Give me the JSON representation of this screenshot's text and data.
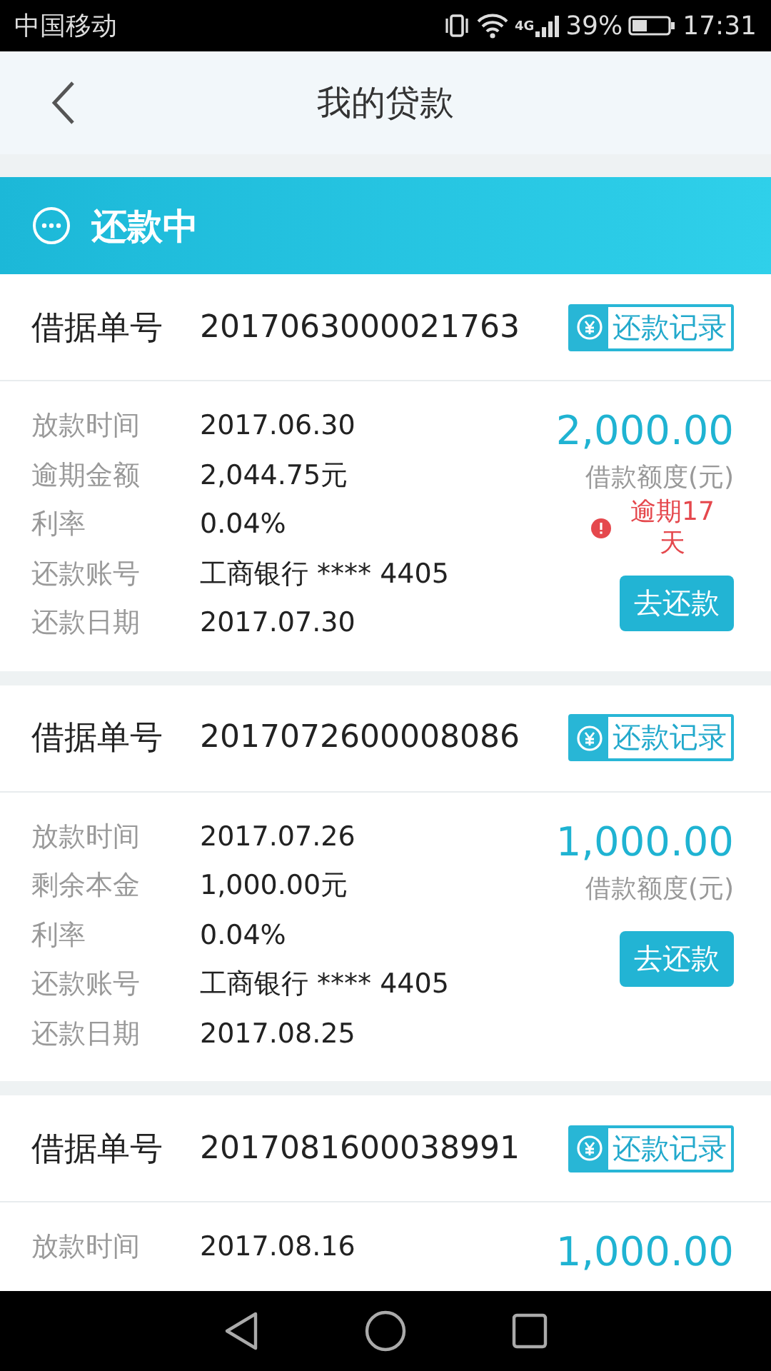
{
  "status_bar": {
    "carrier": "中国移动",
    "network": "4G",
    "battery": "39%",
    "time": "17:31"
  },
  "header": {
    "title": "我的贷款"
  },
  "section": {
    "title": "还款中"
  },
  "loans": [
    {
      "id_label": "借据单号",
      "id": "2017063000021763",
      "record_button": "还款记录",
      "details": [
        {
          "label": "放款时间",
          "value": "2017.06.30"
        },
        {
          "label": "逾期金额",
          "value": "2,044.75元"
        },
        {
          "label": "利率",
          "value": "0.04%"
        },
        {
          "label": "还款账号",
          "value": "工商银行 **** 4405"
        },
        {
          "label": "还款日期",
          "value": "2017.07.30"
        }
      ],
      "amount": "2,000.00",
      "amount_label": "借款额度(元)",
      "overdue": "逾期17天",
      "repay_button": "去还款"
    },
    {
      "id_label": "借据单号",
      "id": "2017072600008086",
      "record_button": "还款记录",
      "details": [
        {
          "label": "放款时间",
          "value": "2017.07.26"
        },
        {
          "label": "剩余本金",
          "value": "1,000.00元"
        },
        {
          "label": "利率",
          "value": "0.04%"
        },
        {
          "label": "还款账号",
          "value": "工商银行 **** 4405"
        },
        {
          "label": "还款日期",
          "value": "2017.08.25"
        }
      ],
      "amount": "1,000.00",
      "amount_label": "借款额度(元)",
      "repay_button": "去还款"
    },
    {
      "id_label": "借据单号",
      "id": "2017081600038991",
      "record_button": "还款记录",
      "details": [
        {
          "label": "放款时间",
          "value": "2017.08.16"
        }
      ],
      "amount": "1,000.00"
    }
  ]
}
